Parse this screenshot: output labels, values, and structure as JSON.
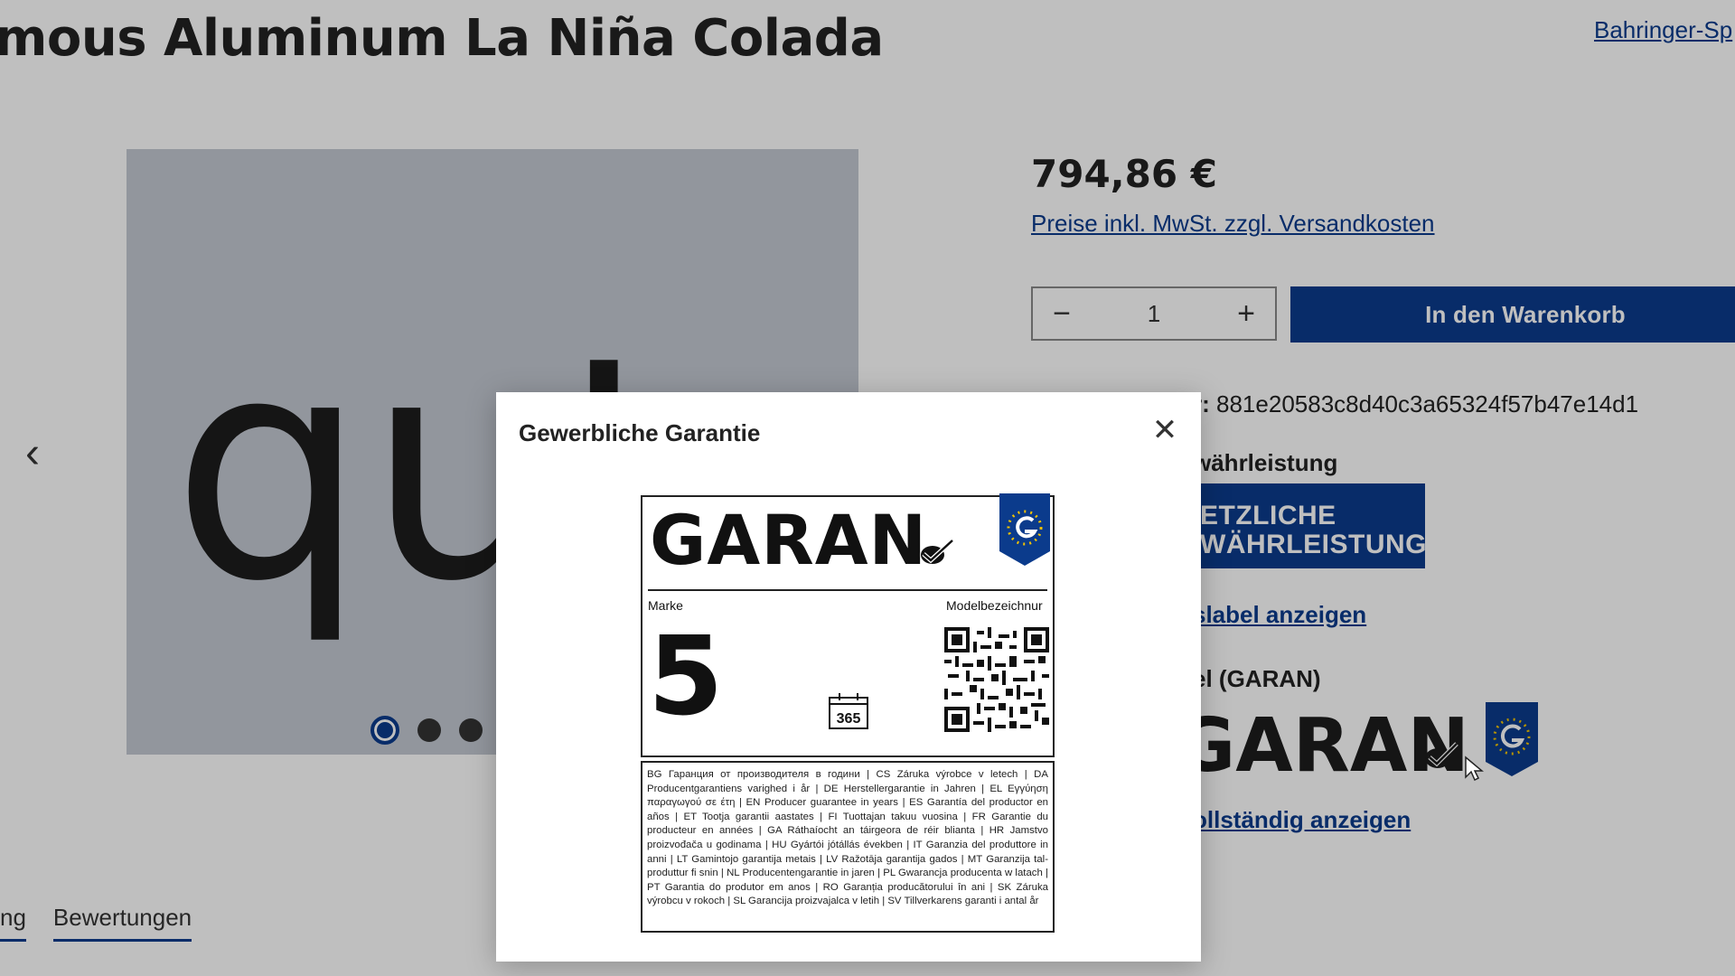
{
  "product": {
    "title": "mous Aluminum La Niña Colada",
    "brand_link": "Bahringer-Sp",
    "gallery_word": "qu",
    "gallery_hidden_letter": "t",
    "price": "794,86 €",
    "price_note": "Preise inkl. MwSt. zzgl. Versandkosten",
    "quantity": "1",
    "cart_label": "In den Warenkorb",
    "sku_label": "r:",
    "sku_value": "881e20583c8d40c3a65324f57b47e14d1",
    "warranty_heading": "währleistung",
    "badge_line1": "ETZLICHE",
    "badge_line2": "WÄHRLEISTUNG",
    "label_link": "slabel anzeigen",
    "garan_heading": "el (GARAN)",
    "garan_word": "GARAN",
    "full_link": "ollständig anzeigen"
  },
  "tabs": [
    "ng",
    "Bewertungen"
  ],
  "modal": {
    "title": "Gewerbliche Garantie",
    "label": {
      "logo_text": "GARAN",
      "marke": "Marke",
      "modelbezeichnung": "Modelbezeichnur",
      "years": "5",
      "calendar": "365",
      "translations": "BG Гаранция от производителя в години | CS Záruka výrobce v letech | DA Producentgarantiens varighed i år | DE Herstellergarantie in Jahren | EL Εγγύηση παραγωγού σε έτη | EN Producer guarantee in years | ES Garantía del productor en años | ET Tootja garantii aastates | FI Tuottajan takuu vuosina | FR Garantie du producteur en années | GA Ráthaíocht an táirgeora de réir blianta | HR Jamstvo proizvođača u godinama | HU Gyártói jótállás években | IT Garanzia del produttore in anni | LT Gamintojo garantija metais | LV Ražotāja garantija gados | MT Garanzija tal-produttur fi snin | NL Producentengarantie in jaren | PL Gwarancja producenta w latach | PT Garantia do produtor em anos | RO Garanția producătorului în ani | SK Záruka výrobcu v rokoch | SL Garancija proizvajalca v letih | SV Tillverkarens garanti i antal år"
    }
  },
  "colors": {
    "brand": "#0b3b8c",
    "overlay": "rgba(0,0,0,0.25)"
  },
  "icons": [
    "chevron-left-icon",
    "close-icon",
    "minus-icon",
    "plus-icon",
    "eu-shield-icon",
    "checkmark-icon",
    "calendar-icon",
    "qr-code-icon",
    "mouse-cursor-icon"
  ]
}
